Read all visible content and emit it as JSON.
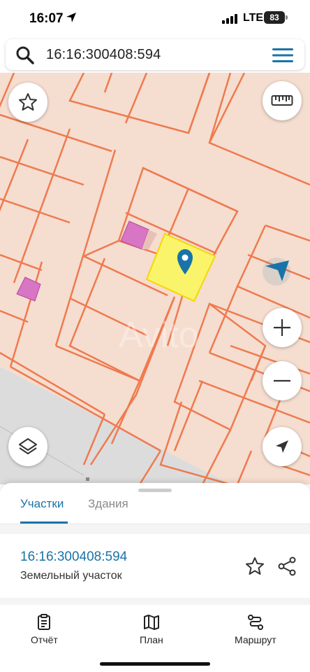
{
  "status_bar": {
    "time": "16:07",
    "network": "LTE",
    "battery": "83"
  },
  "search": {
    "query": "16:16:300408:594"
  },
  "map": {
    "watermark": "Avito",
    "colors": {
      "background": "#f5ddd0",
      "parcel_border": "#ef7a4e",
      "selected_parcel": "#f9f46a",
      "building": "#d875c4",
      "road": "#dcdcdc",
      "pin": "#1a73a8"
    }
  },
  "sheet": {
    "tabs": [
      {
        "label": "Участки",
        "active": true
      },
      {
        "label": "Здания",
        "active": false
      }
    ],
    "result": {
      "cadastral_number": "16:16:300408:594",
      "type": "Земельный участок"
    }
  },
  "bottom_nav": {
    "items": [
      {
        "label": "Отчёт",
        "icon": "report-icon"
      },
      {
        "label": "План",
        "icon": "map-icon"
      },
      {
        "label": "Маршрут",
        "icon": "route-icon"
      }
    ]
  }
}
